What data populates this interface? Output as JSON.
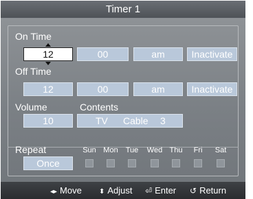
{
  "window": {
    "title": "Timer 1"
  },
  "on_time": {
    "label": "On Time",
    "hour": "12",
    "minute": "00",
    "ampm": "am",
    "state": "Inactivate"
  },
  "off_time": {
    "label": "Off Time",
    "hour": "12",
    "minute": "00",
    "ampm": "am",
    "state": "Inactivate"
  },
  "volume": {
    "label": "Volume",
    "value": "10"
  },
  "contents": {
    "label": "Contents",
    "source": "TV",
    "type": "Cable",
    "channel": "3"
  },
  "repeat": {
    "label": "Repeat",
    "value": "Once",
    "days": [
      "Sun",
      "Mon",
      "Tue",
      "Wed",
      "Thu",
      "Fri",
      "Sat"
    ]
  },
  "footer": {
    "move": "Move",
    "adjust": "Adjust",
    "enter": "Enter",
    "return": "Return"
  },
  "colors": {
    "field": "#b9c8da",
    "panel": "#7b8085",
    "selected_field": "#ffffff"
  }
}
